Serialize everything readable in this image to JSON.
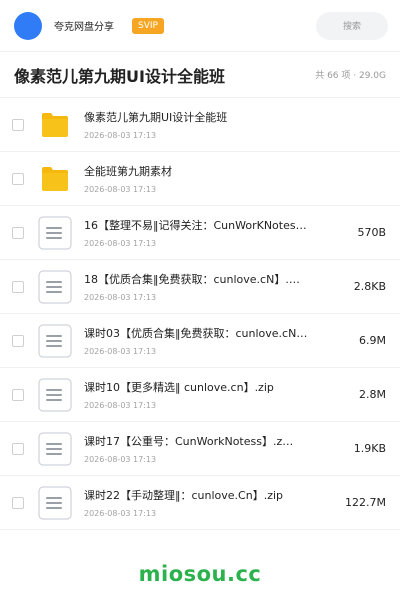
{
  "header": {
    "brand": "夸克网盘分享",
    "badge": "SVIP",
    "search_label": "搜索"
  },
  "folder": {
    "title": "像素范儿第九期UI设计全能班",
    "meta": "共 66 项 · 29.0G"
  },
  "items": [
    {
      "type": "folder",
      "name": "像素范儿第九期UI设计全能班",
      "date": "2026-08-03 17:13",
      "size": ""
    },
    {
      "type": "folder",
      "name": "全能班第九期素材",
      "date": "2026-08-03 17:13",
      "size": ""
    },
    {
      "type": "file",
      "name": "16【整理不易‖记得关注：CunWorKNotes…",
      "date": "2026-08-03 17:13",
      "size": "570B"
    },
    {
      "type": "file",
      "name": "18【优质合集‖免费获取：cunlove.cN】.…",
      "date": "2026-08-03 17:13",
      "size": "2.8KB"
    },
    {
      "type": "file",
      "name": "课时03【优质合集‖免费获取：cunlove.cN…",
      "date": "2026-08-03 17:13",
      "size": "6.9M"
    },
    {
      "type": "file",
      "name": "课时10【更多精选‖ cunlove.cn】.zip",
      "date": "2026-08-03 17:13",
      "size": "2.8M"
    },
    {
      "type": "file",
      "name": "课时17【公重号：CunWorkNotess】.z…",
      "date": "2026-08-03 17:13",
      "size": "1.9KB"
    },
    {
      "type": "file",
      "name": "课时22【手动整理‖：cunlove.Cn】.zip",
      "date": "2026-08-03 17:13",
      "size": "122.7M"
    }
  ],
  "footer": {
    "logo": "miosou.cc"
  },
  "colors": {
    "avatar": "#2f7cf6",
    "svip_badge": "#f6a623",
    "folder_icon": "#f7c21a",
    "footer_logo": "#2bb24c"
  },
  "icons": {
    "folder": "folder-icon",
    "file": "document-icon"
  }
}
